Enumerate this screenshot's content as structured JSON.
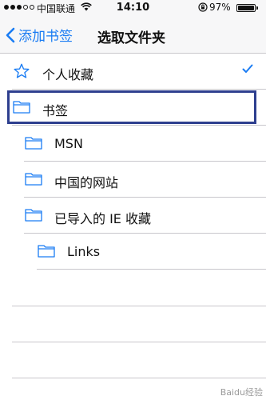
{
  "status_bar": {
    "carrier": "中国联通",
    "time": "14:10",
    "battery": "97%",
    "battery_level": 0.97
  },
  "nav": {
    "back_label": "添加书签",
    "title": "选取文件夹"
  },
  "items": [
    {
      "label": "个人收藏",
      "icon": "star-icon",
      "checked": true
    },
    {
      "label": "书签",
      "icon": "folder-icon",
      "selected_highlight": true
    },
    {
      "label": "MSN",
      "icon": "folder-icon"
    },
    {
      "label": "中国的网站",
      "icon": "folder-icon"
    },
    {
      "label": "已导入的 IE 收藏",
      "icon": "folder-icon"
    },
    {
      "label": "Links",
      "icon": "folder-icon"
    }
  ],
  "watermark": "Baidu经验",
  "colors": {
    "accent": "#1a7cf3",
    "highlight_border": "#2e3f8f",
    "separator": "#c8c7cc"
  }
}
